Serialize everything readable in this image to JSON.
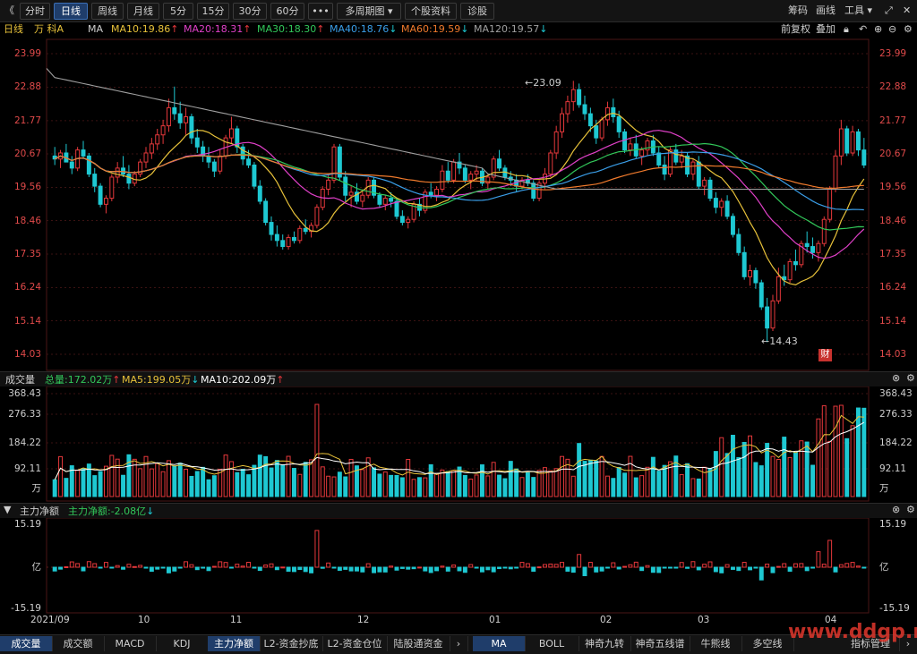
{
  "toolbar": {
    "back": "《",
    "periods": [
      "分时",
      "日线",
      "周线",
      "月线",
      "5分",
      "15分",
      "30分",
      "60分"
    ],
    "active_period": "日线",
    "more": "•••",
    "multi_period": "多周期图",
    "stock_info": "个股资料",
    "diagnose": "诊股",
    "chips": "筹码",
    "draw": "画线",
    "tools": "工具",
    "window_icons": [
      "expand-icon",
      "close-icon"
    ]
  },
  "info": {
    "period": "日线",
    "stock": "万 科A",
    "ma_label": "MA",
    "ma": [
      {
        "label": "MA10:19.86",
        "arrow": "↑",
        "color": "#e8c23a"
      },
      {
        "label": "MA20:18.31",
        "arrow": "↑",
        "color": "#e040c8"
      },
      {
        "label": "MA30:18.30",
        "arrow": "↑",
        "color": "#32c85a"
      },
      {
        "label": "MA40:18.76",
        "arrow": "↓",
        "color": "#3a9ee8"
      },
      {
        "label": "MA60:19.59",
        "arrow": "↓",
        "color": "#f07a2c"
      },
      {
        "label": "MA120:19.57",
        "arrow": "↓",
        "color": "#a0a0a0"
      }
    ],
    "adjust": "前复权",
    "overlay": "叠加"
  },
  "price_axis": [
    "23.99",
    "22.88",
    "21.77",
    "20.67",
    "19.56",
    "18.46",
    "17.35",
    "16.24",
    "15.14",
    "14.03"
  ],
  "annotations": {
    "high": "23.09",
    "low": "14.43",
    "fin_badge": "财"
  },
  "volume_header": {
    "title": "成交量",
    "total": "总量:172.02万",
    "ma5": "MA5:199.05万",
    "ma10": "MA10:202.09万"
  },
  "volume_axis": [
    "368.43",
    "276.33",
    "184.22",
    "92.11",
    "万"
  ],
  "flow_header": {
    "title": "主力净额",
    "value": "主力净额:-2.08亿"
  },
  "flow_axis": [
    "15.19",
    "亿",
    "-15.19"
  ],
  "x_axis": [
    "2021/09",
    "10",
    "11",
    "12",
    "01",
    "02",
    "03",
    "04"
  ],
  "bottom_tabs_left": [
    "成交量",
    "成交额",
    "MACD",
    "KDJ",
    "主力净额",
    "L2-资金抄底",
    "L2-资金仓位",
    "陆股通资金"
  ],
  "bottom_tabs_right": [
    "MA",
    "BOLL",
    "神奇九转",
    "神奇五线谱",
    "牛熊线",
    "多空线",
    "指标管理"
  ],
  "watermark": "www.ddgp.net",
  "colors": {
    "up": "#e5383b",
    "down": "#1ec8d2",
    "bg": "#000000",
    "grid": "#2b1010"
  },
  "chart_data": {
    "type": "candlestick",
    "note": "approximate daily OHLC series read from the screenshot",
    "price_range": [
      14.03,
      23.99
    ],
    "ohlc": [
      [
        20.6,
        20.9,
        20.3,
        20.5
      ],
      [
        20.5,
        20.8,
        20.2,
        20.7
      ],
      [
        20.7,
        21.0,
        20.4,
        20.4
      ],
      [
        20.4,
        20.6,
        20.0,
        20.2
      ],
      [
        20.2,
        20.9,
        20.1,
        20.8
      ],
      [
        20.8,
        21.1,
        20.5,
        20.6
      ],
      [
        20.6,
        20.7,
        19.9,
        20.0
      ],
      [
        20.0,
        20.2,
        19.4,
        19.6
      ],
      [
        19.6,
        19.7,
        18.9,
        19.0
      ],
      [
        19.0,
        19.3,
        18.7,
        19.2
      ],
      [
        19.2,
        20.0,
        19.1,
        19.9
      ],
      [
        19.9,
        20.4,
        19.7,
        20.2
      ],
      [
        20.2,
        20.6,
        19.9,
        20.0
      ],
      [
        20.0,
        20.3,
        19.5,
        19.7
      ],
      [
        19.7,
        20.1,
        19.6,
        20.0
      ],
      [
        20.0,
        20.5,
        19.9,
        20.4
      ],
      [
        20.4,
        20.9,
        20.2,
        20.7
      ],
      [
        20.7,
        21.2,
        20.5,
        21.0
      ],
      [
        21.0,
        21.5,
        20.8,
        21.3
      ],
      [
        21.3,
        21.8,
        21.0,
        21.6
      ],
      [
        21.6,
        22.5,
        21.4,
        22.2
      ],
      [
        22.2,
        22.9,
        21.8,
        22.0
      ],
      [
        22.0,
        22.4,
        21.5,
        21.7
      ],
      [
        21.7,
        22.2,
        21.3,
        21.9
      ],
      [
        21.9,
        22.0,
        21.0,
        21.2
      ],
      [
        21.2,
        21.5,
        20.7,
        20.9
      ],
      [
        20.9,
        21.1,
        20.4,
        20.6
      ],
      [
        20.6,
        20.9,
        20.2,
        20.4
      ],
      [
        20.4,
        20.5,
        19.9,
        20.1
      ],
      [
        20.1,
        20.8,
        20.0,
        20.6
      ],
      [
        20.6,
        21.3,
        20.5,
        21.2
      ],
      [
        21.2,
        21.9,
        21.0,
        21.5
      ],
      [
        21.5,
        21.6,
        20.7,
        20.9
      ],
      [
        20.9,
        21.0,
        20.3,
        20.5
      ],
      [
        20.5,
        20.8,
        20.2,
        20.3
      ],
      [
        20.3,
        20.4,
        19.5,
        19.6
      ],
      [
        19.6,
        19.8,
        19.0,
        19.1
      ],
      [
        19.1,
        19.2,
        18.3,
        18.4
      ],
      [
        18.4,
        18.6,
        17.8,
        18.0
      ],
      [
        18.0,
        18.3,
        17.6,
        17.8
      ],
      [
        17.8,
        18.0,
        17.5,
        17.6
      ],
      [
        17.6,
        18.0,
        17.5,
        17.9
      ],
      [
        17.9,
        18.1,
        17.7,
        17.8
      ],
      [
        17.8,
        18.3,
        17.7,
        18.2
      ],
      [
        18.2,
        18.5,
        18.0,
        18.1
      ],
      [
        18.1,
        18.4,
        17.9,
        18.3
      ],
      [
        18.3,
        19.0,
        18.2,
        18.9
      ],
      [
        18.9,
        19.6,
        18.8,
        19.5
      ],
      [
        19.5,
        20.0,
        19.3,
        19.8
      ],
      [
        19.8,
        21.0,
        19.7,
        20.9
      ],
      [
        20.9,
        21.0,
        19.8,
        19.9
      ],
      [
        19.9,
        20.1,
        19.1,
        19.3
      ],
      [
        19.3,
        19.6,
        18.9,
        19.4
      ],
      [
        19.4,
        19.7,
        19.0,
        19.1
      ],
      [
        19.1,
        19.5,
        18.9,
        19.3
      ],
      [
        19.3,
        19.9,
        19.2,
        19.8
      ],
      [
        19.8,
        19.9,
        19.2,
        19.3
      ],
      [
        19.3,
        19.4,
        18.9,
        19.0
      ],
      [
        19.0,
        19.3,
        18.8,
        19.2
      ],
      [
        19.2,
        19.4,
        18.9,
        19.1
      ],
      [
        19.1,
        19.2,
        18.5,
        18.6
      ],
      [
        18.6,
        18.8,
        18.3,
        18.4
      ],
      [
        18.4,
        18.6,
        18.2,
        18.5
      ],
      [
        18.5,
        19.1,
        18.4,
        19.0
      ],
      [
        19.0,
        19.2,
        18.6,
        18.8
      ],
      [
        18.8,
        19.5,
        18.7,
        19.4
      ],
      [
        19.4,
        19.7,
        19.2,
        19.3
      ],
      [
        19.3,
        19.6,
        19.1,
        19.5
      ],
      [
        19.5,
        20.3,
        19.4,
        20.1
      ],
      [
        20.1,
        20.4,
        19.7,
        19.8
      ],
      [
        19.8,
        20.5,
        19.7,
        20.4
      ],
      [
        20.4,
        20.7,
        20.0,
        20.2
      ],
      [
        20.2,
        20.3,
        19.7,
        19.8
      ],
      [
        19.8,
        20.1,
        19.5,
        20.0
      ],
      [
        20.0,
        20.3,
        19.8,
        20.1
      ],
      [
        20.1,
        20.2,
        19.6,
        19.7
      ],
      [
        19.7,
        20.0,
        19.5,
        19.9
      ],
      [
        19.9,
        20.6,
        19.8,
        20.5
      ],
      [
        20.5,
        20.8,
        20.1,
        20.2
      ],
      [
        20.2,
        20.3,
        19.8,
        19.9
      ],
      [
        19.9,
        20.1,
        19.6,
        19.8
      ],
      [
        19.8,
        20.0,
        19.4,
        19.6
      ],
      [
        19.6,
        19.9,
        19.5,
        19.8
      ],
      [
        19.8,
        20.0,
        19.6,
        19.7
      ],
      [
        19.7,
        19.8,
        19.1,
        19.2
      ],
      [
        19.2,
        19.8,
        19.1,
        19.7
      ],
      [
        19.7,
        20.2,
        19.5,
        20.0
      ],
      [
        20.0,
        20.8,
        19.9,
        20.7
      ],
      [
        20.7,
        21.6,
        20.5,
        21.4
      ],
      [
        21.4,
        22.2,
        21.2,
        22.0
      ],
      [
        22.0,
        22.6,
        21.7,
        22.4
      ],
      [
        22.4,
        23.09,
        22.1,
        22.8
      ],
      [
        22.8,
        23.0,
        22.2,
        22.3
      ],
      [
        22.3,
        22.6,
        21.8,
        22.0
      ],
      [
        22.0,
        22.2,
        21.4,
        21.6
      ],
      [
        21.6,
        21.8,
        21.0,
        21.2
      ],
      [
        21.2,
        21.9,
        21.1,
        21.8
      ],
      [
        21.8,
        22.4,
        21.6,
        22.2
      ],
      [
        22.2,
        22.5,
        21.7,
        21.9
      ],
      [
        21.9,
        22.1,
        21.2,
        21.4
      ],
      [
        21.4,
        21.5,
        20.7,
        20.8
      ],
      [
        20.8,
        21.2,
        20.6,
        21.0
      ],
      [
        21.0,
        21.3,
        20.5,
        20.6
      ],
      [
        20.6,
        20.9,
        20.3,
        20.8
      ],
      [
        20.8,
        21.2,
        20.6,
        21.1
      ],
      [
        21.1,
        21.3,
        20.6,
        20.7
      ],
      [
        20.7,
        20.9,
        20.2,
        20.3
      ],
      [
        20.3,
        20.6,
        19.8,
        20.0
      ],
      [
        20.0,
        20.9,
        19.9,
        20.8
      ],
      [
        20.8,
        21.0,
        20.3,
        20.4
      ],
      [
        20.4,
        20.8,
        20.2,
        20.6
      ],
      [
        20.6,
        20.7,
        19.9,
        20.0
      ],
      [
        20.0,
        20.5,
        19.8,
        20.4
      ],
      [
        20.4,
        20.6,
        19.5,
        19.6
      ],
      [
        19.6,
        19.9,
        19.3,
        19.8
      ],
      [
        19.8,
        19.9,
        19.1,
        19.2
      ],
      [
        19.2,
        19.4,
        18.7,
        18.9
      ],
      [
        18.9,
        19.2,
        18.6,
        19.1
      ],
      [
        19.1,
        19.3,
        18.5,
        18.6
      ],
      [
        18.6,
        18.7,
        17.9,
        18.0
      ],
      [
        18.0,
        18.2,
        17.3,
        17.4
      ],
      [
        17.4,
        17.6,
        16.5,
        16.6
      ],
      [
        16.6,
        17.0,
        16.3,
        16.8
      ],
      [
        16.8,
        16.9,
        16.2,
        16.4
      ],
      [
        16.4,
        16.5,
        15.5,
        15.6
      ],
      [
        15.6,
        15.9,
        14.43,
        14.9
      ],
      [
        14.9,
        16.0,
        14.8,
        15.8
      ],
      [
        15.8,
        16.9,
        15.7,
        16.6
      ],
      [
        16.6,
        17.0,
        16.3,
        16.5
      ],
      [
        16.5,
        17.2,
        16.4,
        17.1
      ],
      [
        17.1,
        17.5,
        16.8,
        17.0
      ],
      [
        17.0,
        17.8,
        16.9,
        17.7
      ],
      [
        17.7,
        18.1,
        17.4,
        17.6
      ],
      [
        17.6,
        17.9,
        17.2,
        17.4
      ],
      [
        17.4,
        17.8,
        17.1,
        17.7
      ],
      [
        17.7,
        18.6,
        17.6,
        18.5
      ],
      [
        18.5,
        19.6,
        18.4,
        19.5
      ],
      [
        19.5,
        20.8,
        19.4,
        20.6
      ],
      [
        20.6,
        21.8,
        20.3,
        21.5
      ],
      [
        21.5,
        21.6,
        20.6,
        20.7
      ],
      [
        20.7,
        21.6,
        20.6,
        21.4
      ],
      [
        21.4,
        21.5,
        20.6,
        20.8
      ],
      [
        20.8,
        21.2,
        20.2,
        20.3
      ]
    ],
    "volume_range": [
      0,
      368.43
    ],
    "flow_range": [
      -15.19,
      15.19
    ]
  }
}
